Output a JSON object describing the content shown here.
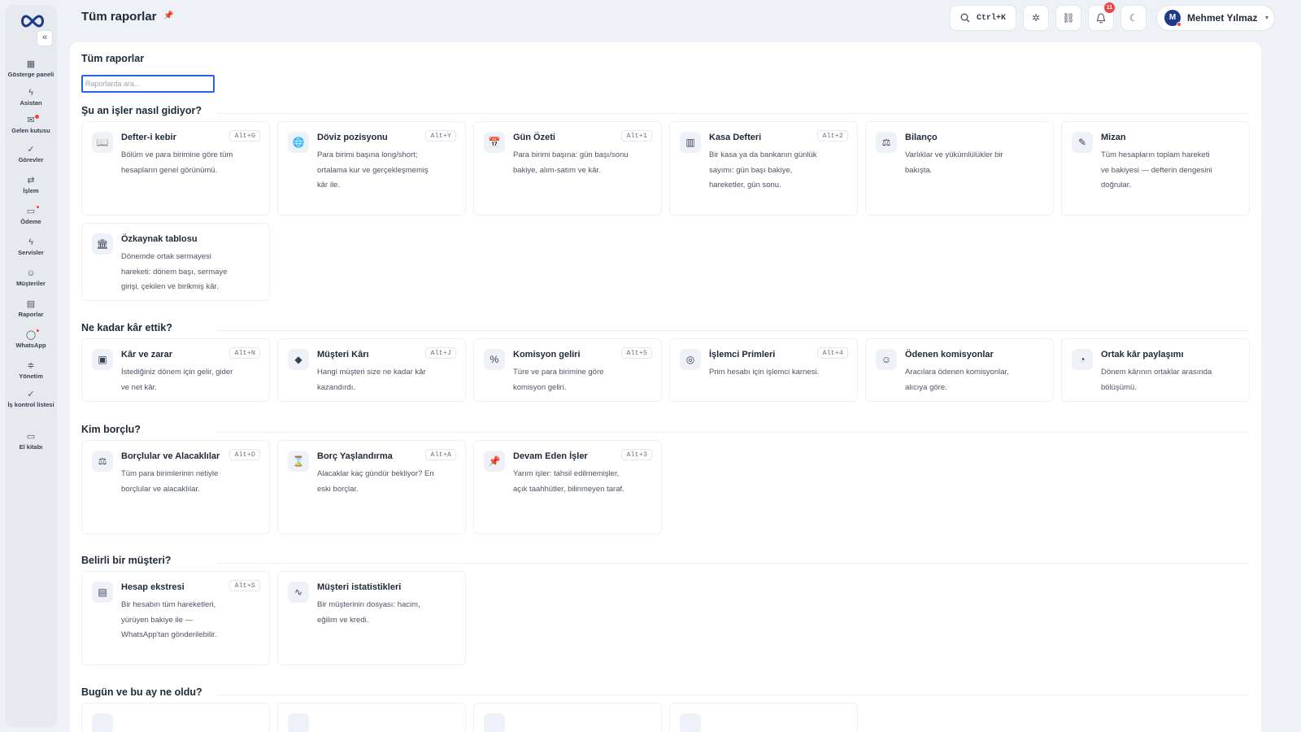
{
  "app": {
    "title": "Tüm raporlar"
  },
  "sidebar": {
    "collapse_label": "«",
    "items": [
      {
        "label": "Gösterge paneli",
        "icon": "grid-icon",
        "glyph": "▦"
      },
      {
        "label": "Asistan",
        "icon": "bolt-icon",
        "glyph": "ϟ"
      },
      {
        "label": "Gelen kutusu",
        "icon": "inbox-icon",
        "glyph": "✉"
      },
      {
        "label": "Görevler",
        "icon": "check-icon",
        "glyph": "✓"
      },
      {
        "label": "İşlem",
        "icon": "swap-icon",
        "glyph": "⇄"
      },
      {
        "label": "Ödeme",
        "icon": "payment-icon",
        "glyph": "▭"
      },
      {
        "label": "Servisler",
        "icon": "bolt-icon",
        "glyph": "ϟ"
      },
      {
        "label": "Müşteriler",
        "icon": "users-icon",
        "glyph": "☺"
      },
      {
        "label": "Raporlar",
        "icon": "report-icon",
        "glyph": "▤"
      },
      {
        "label": "WhatsApp",
        "icon": "chat-icon",
        "glyph": "◯"
      },
      {
        "label": "Yönetim",
        "icon": "sliders-icon",
        "glyph": "≑"
      },
      {
        "label": "İş kontrol listesi",
        "icon": "check-icon",
        "glyph": "✓"
      },
      {
        "label": "El kitabı",
        "icon": "book-icon",
        "glyph": "▭"
      }
    ]
  },
  "topbar": {
    "title": "Tüm raporlar",
    "search_shortcut": "Ctrl+K",
    "notification_count": "11",
    "user_initial": "M",
    "user_name": "Mehmet Yılmaz"
  },
  "main": {
    "title": "Tüm raporlar",
    "search_placeholder": "Raporlarda ara...",
    "sections": [
      {
        "title": "Şu an işler nasıl gidiyor?",
        "cards": [
          {
            "title": "Defter-i kebir",
            "shortcut": "Alt+G",
            "icon": "book-icon",
            "glyph": "📖",
            "desc": "Bölüm ve para birimine göre tüm hesapların genel görünümü."
          },
          {
            "title": "Döviz pozisyonu",
            "shortcut": "Alt+Y",
            "icon": "globe-icon",
            "glyph": "🌐",
            "desc": "Para birimi başına long/short; ortalama kur ve gerçekleşmemiş kâr ile."
          },
          {
            "title": "Gün Özeti",
            "shortcut": "Alt+1",
            "icon": "calendar-icon",
            "glyph": "📅",
            "desc": "Para birimi başına: gün başı/sonu bakiye, alım-satım ve kâr."
          },
          {
            "title": "Kasa Defteri",
            "shortcut": "Alt+2",
            "icon": "ledger-icon",
            "glyph": "▥",
            "desc": "Bir kasa ya da bankanın günlük sayımı: gün başı bakiye, hareketler, gün sonu."
          },
          {
            "title": "Bilanço",
            "shortcut": "",
            "icon": "scale-icon",
            "glyph": "⚖",
            "desc": "Varlıklar ve yükümlülükler bir bakışta."
          },
          {
            "title": "Mizan",
            "shortcut": "",
            "icon": "pen-icon",
            "glyph": "✎",
            "desc": "Tüm hesapların toplam hareketi ve bakiyesi — defterin dengesini doğrular."
          },
          {
            "title": "Özkaynak tablosu",
            "shortcut": "",
            "icon": "bank-icon",
            "glyph": "🏛",
            "desc": "Dönemde ortak sermayesi hareketi: dönem başı, sermaye girişi, çekilen ve birikmiş kâr."
          }
        ]
      },
      {
        "title": "Ne kadar kâr ettik?",
        "cards": [
          {
            "title": "Kâr ve zarar",
            "shortcut": "Alt+N",
            "icon": "wallet-icon",
            "glyph": "▣",
            "desc": "İstediğiniz dönem için gelir, gider ve net kâr."
          },
          {
            "title": "Müşteri Kârı",
            "shortcut": "Alt+J",
            "icon": "gem-icon",
            "glyph": "◆",
            "desc": "Hangi müşteri size ne kadar kâr kazandırdı."
          },
          {
            "title": "Komisyon geliri",
            "shortcut": "Alt+5",
            "icon": "percent-icon",
            "glyph": "%",
            "desc": "Türe ve para birimine göre komisyon geliri."
          },
          {
            "title": "İşlemci Primleri",
            "shortcut": "Alt+4",
            "icon": "target-icon",
            "glyph": "◎",
            "desc": "Prim hesabı için işlemci karnesi."
          },
          {
            "title": "Ödenen komisyonlar",
            "shortcut": "",
            "icon": "users-icon",
            "glyph": "☺",
            "desc": "Aracılara ödenen komisyonlar, alıcıya göre."
          },
          {
            "title": "Ortak kâr paylaşımı",
            "shortcut": "",
            "icon": "coins-icon",
            "glyph": "◔",
            "desc": "Dönem kârının ortaklar arasında bölüşümü."
          }
        ]
      },
      {
        "title": "Kim borçlu?",
        "cards": [
          {
            "title": "Borçlular ve Alacaklılar",
            "shortcut": "Alt+D",
            "icon": "scale-icon",
            "glyph": "⚖",
            "desc": "Tüm para birimlerinin netiyle borçlular ve alacaklılar."
          },
          {
            "title": "Borç Yaşlandırma",
            "shortcut": "Alt+A",
            "icon": "hourglass-icon",
            "glyph": "⌛",
            "desc": "Alacaklar kaç gündür bekliyor? En eski borçlar."
          },
          {
            "title": "Devam Eden İşler",
            "shortcut": "Alt+3",
            "icon": "pin-icon",
            "glyph": "📌",
            "desc": "Yarım işler: tahsil edilmemişler, açık taahhütler, bilinmeyen taraf."
          }
        ]
      },
      {
        "title": "Belirli bir müşteri?",
        "cards": [
          {
            "title": "Hesap ekstresi",
            "shortcut": "Alt+S",
            "icon": "document-icon",
            "glyph": "▤",
            "desc": "Bir hesabın tüm hareketleri, yürüyen bakiye ile — WhatsApp'tan gönderilebilir."
          },
          {
            "title": "Müşteri istatistikleri",
            "shortcut": "",
            "icon": "pulse-icon",
            "glyph": "∿",
            "desc": "Bir müşterinin dosyası: hacim, eğilim ve kredi."
          }
        ]
      },
      {
        "title": "Bugün ve bu ay ne oldu?",
        "cards": [
          {
            "title": "",
            "shortcut": "",
            "icon": "report-icon",
            "glyph": "",
            "desc": ""
          },
          {
            "title": "",
            "shortcut": "",
            "icon": "report-icon",
            "glyph": "",
            "desc": ""
          },
          {
            "title": "",
            "shortcut": "",
            "icon": "report-icon",
            "glyph": "",
            "desc": ""
          },
          {
            "title": "",
            "shortcut": "",
            "icon": "report-icon",
            "glyph": "",
            "desc": ""
          }
        ]
      }
    ]
  },
  "colors": {
    "accent": "#1e3a8a",
    "badge": "#ef4444",
    "focus": "#2563eb"
  }
}
